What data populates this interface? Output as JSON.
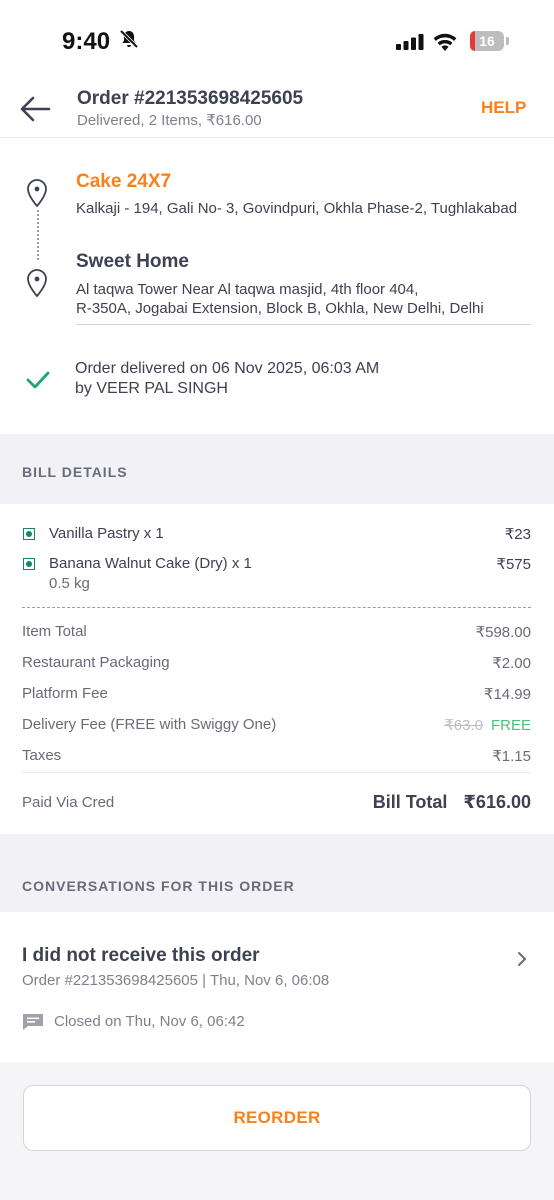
{
  "status_bar": {
    "time": "9:40",
    "battery": "16",
    "battery_level": 0.16
  },
  "header": {
    "title": "Order #221353698425605",
    "subtitle": "Delivered, 2 Items, ₹616.00",
    "help_label": "HELP"
  },
  "restaurant": {
    "name": "Cake 24X7",
    "address": "Kalkaji - 194, Gali No- 3, Govindpuri, Okhla Phase-2, Tughlakabad"
  },
  "delivery": {
    "name": "Sweet Home",
    "address_line1": "Al taqwa Tower Near Al taqwa masjid, 4th floor 404,",
    "address_line2": "R-350A, Jogabai Extension, Block B, Okhla, New Delhi, Delhi"
  },
  "status": {
    "line1": "Order delivered on 06 Nov 2025, 06:03 AM",
    "line2": "by VEER PAL SINGH"
  },
  "bill": {
    "section_title": "BILL DETAILS",
    "items": [
      {
        "name": "Vanilla Pastry x 1",
        "sub": "",
        "price": "₹23"
      },
      {
        "name": "Banana Walnut Cake (Dry) x 1",
        "sub": "0.5 kg",
        "price": "₹575"
      }
    ],
    "rows": [
      {
        "label": "Item Total",
        "value": "₹598.00"
      },
      {
        "label": "Restaurant Packaging",
        "value": "₹2.00"
      },
      {
        "label": "Platform Fee",
        "value": "₹14.99"
      },
      {
        "label": "Delivery Fee (FREE with Swiggy One)",
        "original": "₹63.0",
        "value": "FREE"
      },
      {
        "label": "Taxes",
        "value": "₹1.15"
      }
    ],
    "paid_via": "Paid Via Cred",
    "total_label": "Bill Total",
    "total_value": "₹616.00"
  },
  "conversations": {
    "section_title": "CONVERSATIONS FOR THIS ORDER",
    "title": "I did not receive this order",
    "subtitle": "Order #221353698425605 | Thu, Nov 6, 06:08",
    "closed": "Closed on Thu, Nov 6, 06:42"
  },
  "reorder_label": "REORDER",
  "colors": {
    "accent": "#fc8019",
    "veg": "#0f8a65",
    "free": "#48c479",
    "check": "#1ba672"
  }
}
